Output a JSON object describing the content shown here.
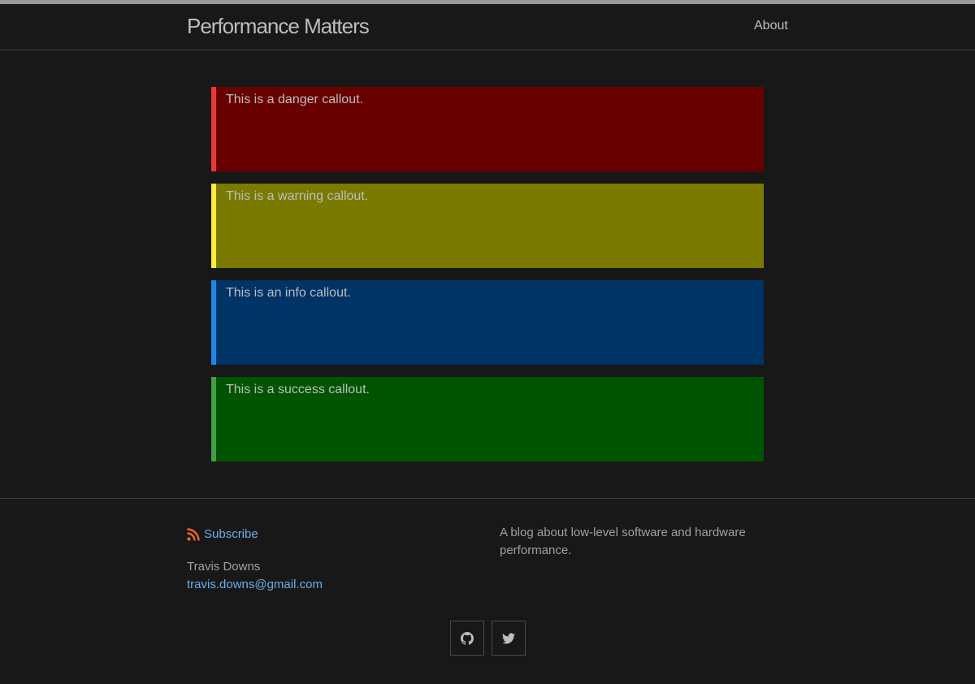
{
  "site": {
    "title": "Performance Matters",
    "nav": [
      {
        "label": "About"
      }
    ]
  },
  "callouts": [
    {
      "type": "danger",
      "text": "This is a danger callout.",
      "bg": "#690000",
      "border": "#e53935"
    },
    {
      "type": "warning",
      "text": "This is a warning callout.",
      "bg": "#7a7a00",
      "border": "#ffeb3b"
    },
    {
      "type": "info",
      "text": "This is an info callout.",
      "bg": "#003366",
      "border": "#1e88e5"
    },
    {
      "type": "success",
      "text": "This is a success callout.",
      "bg": "#005400",
      "border": "#43a047"
    }
  ],
  "footer": {
    "subscribe_label": "Subscribe",
    "subscribe_icon": "rss-icon",
    "author_name": "Travis Downs",
    "email": "travis.downs@gmail.com",
    "description": "A blog about low-level software and hardware performance.",
    "social": [
      {
        "icon": "github-icon"
      },
      {
        "icon": "twitter-icon"
      }
    ]
  },
  "colors": {
    "background": "#181818",
    "link": "#6aaeea",
    "rss": "#f26522"
  }
}
